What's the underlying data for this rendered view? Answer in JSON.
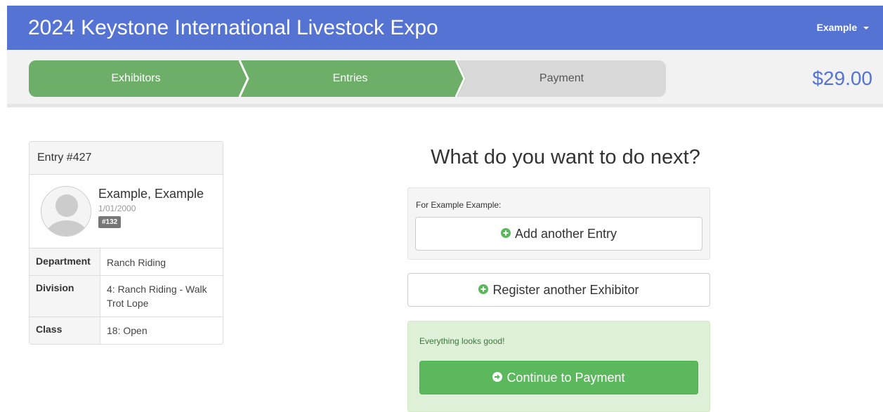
{
  "header": {
    "title": "2024 Keystone International Livestock Expo",
    "user_menu": "Example"
  },
  "steps": [
    {
      "label": "Exhibitors",
      "state": "complete"
    },
    {
      "label": "Entries",
      "state": "complete"
    },
    {
      "label": "Payment",
      "state": "pending"
    }
  ],
  "cart": {
    "total": "$29.00"
  },
  "entry": {
    "heading": "Entry #427",
    "name": "Example, Example",
    "dob": "1/01/2000",
    "badge": "#132",
    "rows": [
      {
        "label": "Department",
        "value": "Ranch Riding"
      },
      {
        "label": "Division",
        "value": "4: Ranch Riding - Walk Trot Lope"
      },
      {
        "label": "Class",
        "value": "18: Open"
      }
    ]
  },
  "next": {
    "heading": "What do you want to do next?",
    "for_label": "For Example Example:",
    "add_entry": "Add another Entry",
    "register_exhibitor": "Register another Exhibitor",
    "status": "Everything looks good!",
    "continue": "Continue to Payment"
  },
  "colors": {
    "navbar": "#5573d3",
    "step_complete": "#6daf69",
    "step_pending": "#d9d9d9",
    "success_bg": "#dff0d8",
    "button_success": "#5cb85c"
  },
  "icons": {
    "add": "plus-circle-icon",
    "continue": "arrow-circle-right-icon",
    "caret": "caret-down-icon",
    "avatar": "avatar-placeholder-icon"
  }
}
